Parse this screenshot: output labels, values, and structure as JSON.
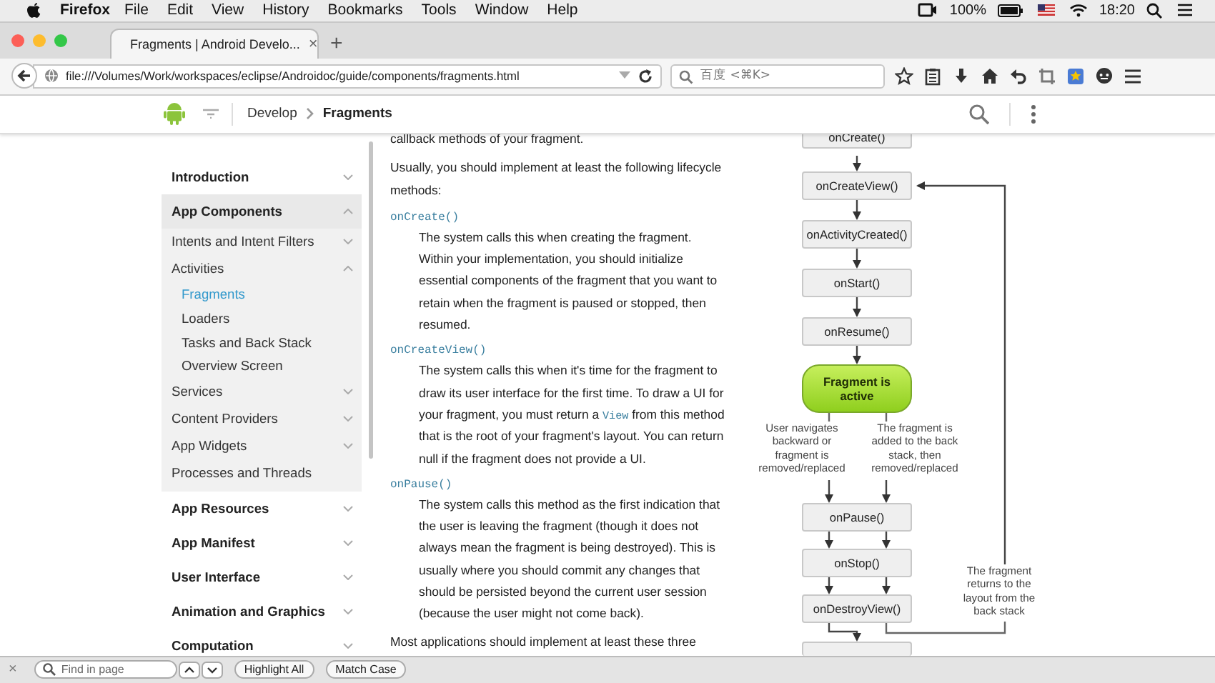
{
  "menubar": {
    "app": "Firefox",
    "items": [
      "File",
      "Edit",
      "View",
      "History",
      "Bookmarks",
      "Tools",
      "Window",
      "Help"
    ],
    "battery": "100%",
    "clock": "18:20"
  },
  "tab": {
    "title": "Fragments | Android Develo...",
    "close": "×",
    "new_tab": "+",
    "selected": true
  },
  "address_bar": {
    "url": "file:///Volumes/Work/workspaces/eclipse/Androidoc/guide/components/fragments.html",
    "search_placeholder": "百度 <⌘K>"
  },
  "header": {
    "breadcrumb": [
      "Develop",
      "Fragments"
    ]
  },
  "sidebar": {
    "items": [
      {
        "label": "Introduction",
        "expanded": false,
        "selected": false
      },
      {
        "label": "App Components",
        "expanded": true,
        "selected": false,
        "children": [
          {
            "label": "Intents and Intent Filters",
            "expanded": false,
            "selected": false
          },
          {
            "label": "Activities",
            "expanded": true,
            "selected": false,
            "children": [
              {
                "label": "Fragments",
                "selected": true
              },
              {
                "label": "Loaders",
                "selected": false
              },
              {
                "label": "Tasks and Back Stack",
                "selected": false
              },
              {
                "label": "Overview Screen",
                "selected": false
              }
            ]
          },
          {
            "label": "Services",
            "expanded": false,
            "selected": false
          },
          {
            "label": "Content Providers",
            "expanded": false,
            "selected": false
          },
          {
            "label": "App Widgets",
            "expanded": false,
            "selected": false
          },
          {
            "label": "Processes and Threads",
            "selected": false
          }
        ]
      },
      {
        "label": "App Resources",
        "expanded": false,
        "selected": false
      },
      {
        "label": "App Manifest",
        "expanded": false,
        "selected": false
      },
      {
        "label": "User Interface",
        "expanded": false,
        "selected": false
      },
      {
        "label": "Animation and Graphics",
        "expanded": false,
        "selected": false
      },
      {
        "label": "Computation",
        "expanded": false,
        "selected": false
      }
    ]
  },
  "article": [
    {
      "kind": "paragraph",
      "text": "callback methods of your fragment."
    },
    {
      "kind": "paragraph",
      "text": "Usually, you should implement at least the following lifecycle methods:"
    },
    {
      "kind": "method",
      "name": "onCreate()",
      "parts": [
        {
          "kind": "text",
          "text": "The system calls this when creating the fragment. Within your implementation, you should initialize essential components of the fragment that you want to retain when the fragment is paused or stopped, then resumed."
        }
      ]
    },
    {
      "kind": "method",
      "name": "onCreateView()",
      "parts": [
        {
          "kind": "text",
          "text": "The system calls this when it's time for the fragment to draw its user interface for the first time. To draw a UI for your fragment, you must return a "
        },
        {
          "kind": "code",
          "text": "View"
        },
        {
          "kind": "text",
          "text": " from this method that is the root of your fragment's layout. You can return null if the fragment does not provide a UI."
        }
      ]
    },
    {
      "kind": "method",
      "name": "onPause()",
      "parts": [
        {
          "kind": "text",
          "text": "The system calls this method as the first indication that the user is leaving the fragment (though it does not always mean the fragment is being destroyed). This is usually where you should commit any changes that should be persisted beyond the current user session (because the user might not come back)."
        }
      ]
    },
    {
      "kind": "paragraph",
      "text": "Most applications should implement at least these three"
    }
  ],
  "diagram": {
    "nodes": [
      {
        "kind": "step",
        "label": "onCreate()"
      },
      {
        "kind": "step",
        "label": "onCreateView()"
      },
      {
        "kind": "step",
        "label": "onActivityCreated()"
      },
      {
        "kind": "step",
        "label": "onStart()"
      },
      {
        "kind": "step",
        "label": "onResume()"
      },
      {
        "kind": "state",
        "label": "Fragment is active"
      },
      {
        "kind": "step",
        "label": "onPause()"
      },
      {
        "kind": "step",
        "label": "onStop()"
      },
      {
        "kind": "step",
        "label": "onDestroyView()"
      }
    ],
    "notes": [
      "User navigates backward or fragment is removed/replaced",
      "The fragment is added to the back stack, then removed/replaced",
      "The fragment returns to the layout from the back stack"
    ]
  },
  "find_bar": {
    "close": "×",
    "placeholder": "Find in page",
    "buttons": [
      "Highlight All",
      "Match Case"
    ]
  }
}
